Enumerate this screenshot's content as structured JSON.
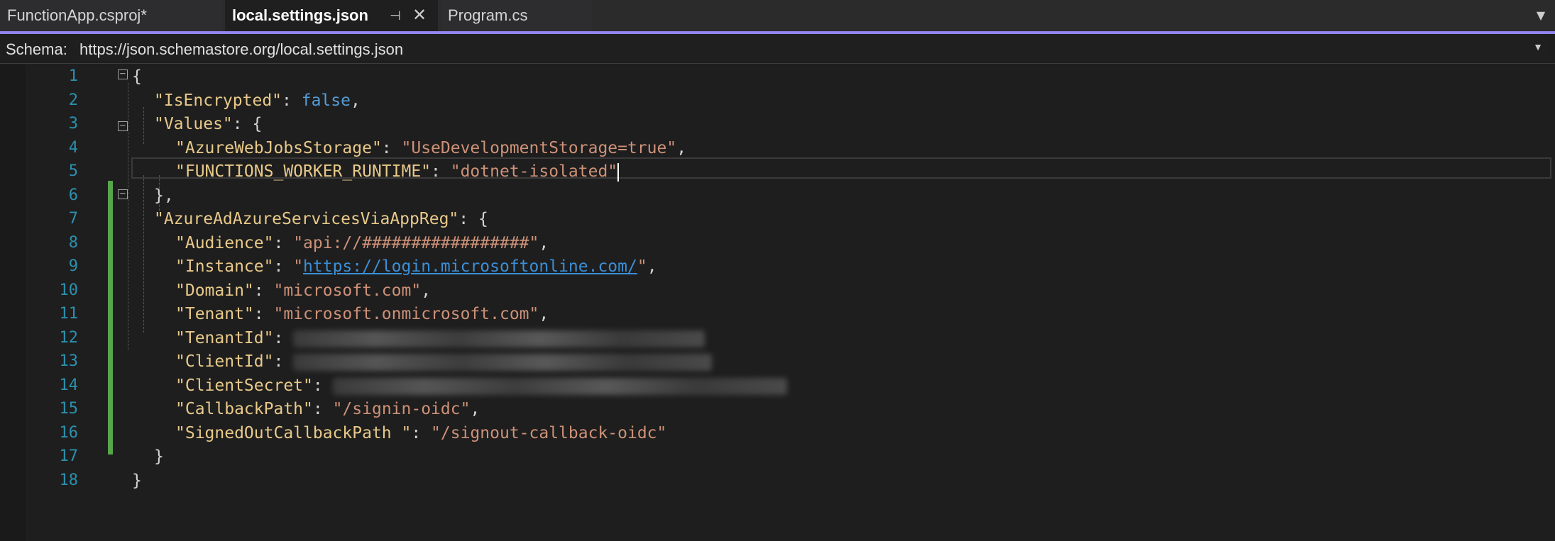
{
  "tabs": [
    {
      "label": "FunctionApp.csproj*",
      "active": false
    },
    {
      "label": "local.settings.json",
      "active": true
    },
    {
      "label": "Program.cs",
      "active": false
    }
  ],
  "schema": {
    "label": "Schema:",
    "url": "https://json.schemastore.org/local.settings.json"
  },
  "line_numbers": [
    "1",
    "2",
    "3",
    "4",
    "5",
    "6",
    "7",
    "8",
    "9",
    "10",
    "11",
    "12",
    "13",
    "14",
    "15",
    "16",
    "17",
    "18"
  ],
  "code": {
    "l1": "{",
    "l2_key": "\"IsEncrypted\"",
    "l2_val": "false",
    "l3_key": "\"Values\"",
    "l3_val": "{",
    "l4_key": "\"AzureWebJobsStorage\"",
    "l4_val": "\"UseDevelopmentStorage=true\"",
    "l5_key": "\"FUNCTIONS_WORKER_RUNTIME\"",
    "l5_val": "\"dotnet-isolated\"",
    "l6": "},",
    "l7_key": "\"AzureAdAzureServicesViaAppReg\"",
    "l7_val": "{",
    "l8_key": "\"Audience\"",
    "l8_val": "\"api://#################\"",
    "l9_key": "\"Instance\"",
    "l9_val_link": "https://login.microsoftonline.com/",
    "l10_key": "\"Domain\"",
    "l10_val": "\"microsoft.com\"",
    "l11_key": "\"Tenant\"",
    "l11_val": "\"microsoft.onmicrosoft.com\"",
    "l12_key": "\"TenantId\"",
    "l13_key": "\"ClientId\"",
    "l14_key": "\"ClientSecret\"",
    "l15_key": "\"CallbackPath\"",
    "l15_val": "\"/signin-oidc\"",
    "l16_key": "\"SignedOutCallbackPath \"",
    "l16_val": "\"/signout-callback-oidc\"",
    "l17": "}",
    "l18": "}"
  },
  "colors": {
    "accent": "#9184ee",
    "line_number": "#2b91af",
    "key": "#e8c98a",
    "string": "#ce9178",
    "keyword": "#569cd6",
    "change_bar": "#57a64a"
  }
}
